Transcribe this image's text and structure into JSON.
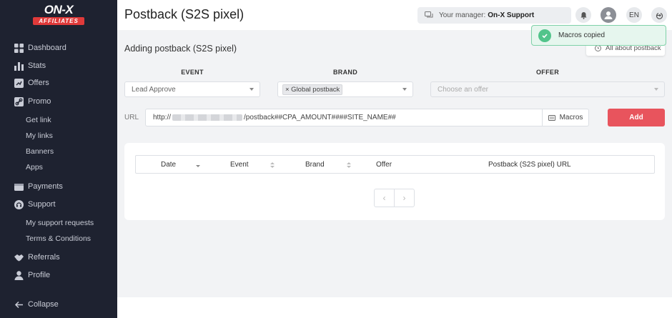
{
  "brand": {
    "logo_top": "ON-X",
    "logo_bottom": "AFFILIATES",
    "accent": "#e03a3a"
  },
  "sidebar": {
    "items": [
      {
        "label": "Dashboard",
        "icon": "grid-icon"
      },
      {
        "label": "Stats",
        "icon": "bar-chart-icon"
      },
      {
        "label": "Offers",
        "icon": "offers-icon"
      },
      {
        "label": "Promo",
        "icon": "link-icon"
      },
      {
        "label": "Get link"
      },
      {
        "label": "My links"
      },
      {
        "label": "Banners"
      },
      {
        "label": "Apps"
      },
      {
        "label": "Payments",
        "icon": "wallet-icon"
      },
      {
        "label": "Support",
        "icon": "headset-icon"
      },
      {
        "label": "My support requests"
      },
      {
        "label": "Terms & Conditions"
      },
      {
        "label": "Referrals",
        "icon": "handshake-icon"
      },
      {
        "label": "Profile",
        "icon": "user-icon"
      }
    ],
    "collapse_label": "Collapse"
  },
  "header": {
    "title": "Postback (S2S pixel)",
    "manager_prefix": "Your manager:",
    "manager_name": "On-X Support",
    "language": "EN"
  },
  "toast": {
    "text": "Macros copied",
    "color": "#52c48b"
  },
  "about_button": "All about postback",
  "form": {
    "section_title": "Adding postback (S2S pixel)",
    "event_label": "EVENT",
    "brand_label": "BRAND",
    "offer_label": "OFFER",
    "event_value": "Lead Approve",
    "brand_tag": "× Global postback",
    "offer_placeholder": "Choose an offer",
    "url_label": "URL",
    "url_prefix": "http://",
    "url_suffix": "/postback##CPA_AMOUNT####SITE_NAME##",
    "macros_button": "Macros",
    "add_button": "Add",
    "add_color": "#e8545d"
  },
  "table": {
    "columns": [
      "Date",
      "Event",
      "Brand",
      "Offer",
      "Postback (S2S pixel) URL"
    ]
  },
  "pagination": {
    "prev": "‹",
    "next": "›"
  }
}
